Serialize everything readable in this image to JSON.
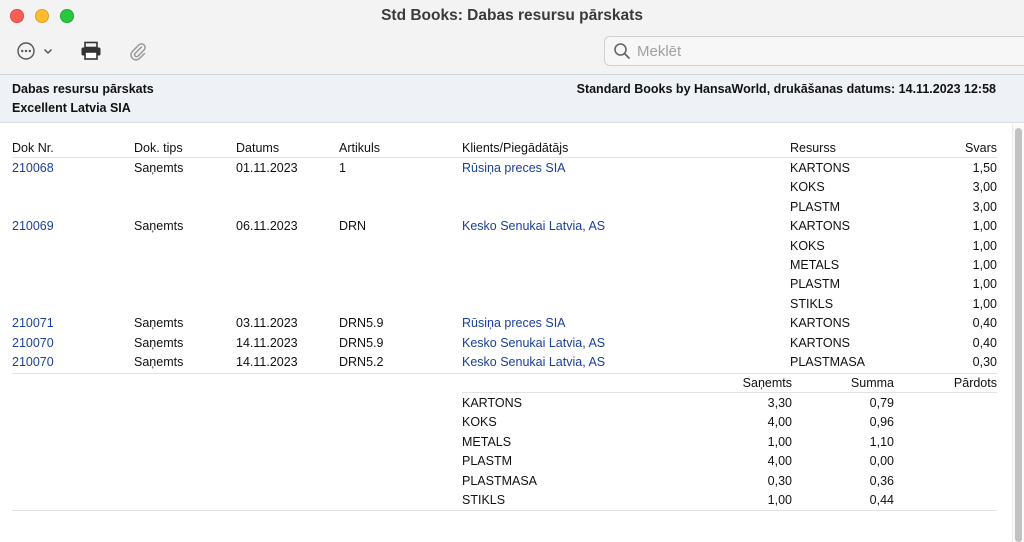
{
  "window": {
    "title": "Std Books: Dabas resursu pārskats"
  },
  "search": {
    "placeholder": "Meklēt"
  },
  "header": {
    "report_title": "Dabas resursu pārskats",
    "company": "Excellent Latvia SIA",
    "printed_info": "Standard Books by HansaWorld, drukāšanas datums: 14.11.2023 12:58"
  },
  "columns": {
    "doc_no": "Dok Nr.",
    "doc_type": "Dok. tips",
    "date": "Datums",
    "item": "Artikuls",
    "client": "Klients/Piegādātājs",
    "resource": "Resurss",
    "weight": "Svars"
  },
  "rows": [
    {
      "doc_no": "210068",
      "doc_type": "Saņemts",
      "date": "01.11.2023",
      "item": "1",
      "client": "Rūsiņa preces SIA",
      "resource": "KARTONS",
      "weight": "1,50"
    },
    {
      "doc_no": "",
      "doc_type": "",
      "date": "",
      "item": "",
      "client": "",
      "resource": "KOKS",
      "weight": "3,00"
    },
    {
      "doc_no": "",
      "doc_type": "",
      "date": "",
      "item": "",
      "client": "",
      "resource": "PLASTM",
      "weight": "3,00"
    },
    {
      "doc_no": "210069",
      "doc_type": "Saņemts",
      "date": "06.11.2023",
      "item": "DRN",
      "client": "Kesko Senukai Latvia, AS",
      "resource": "KARTONS",
      "weight": "1,00"
    },
    {
      "doc_no": "",
      "doc_type": "",
      "date": "",
      "item": "",
      "client": "",
      "resource": "KOKS",
      "weight": "1,00"
    },
    {
      "doc_no": "",
      "doc_type": "",
      "date": "",
      "item": "",
      "client": "",
      "resource": "METALS",
      "weight": "1,00"
    },
    {
      "doc_no": "",
      "doc_type": "",
      "date": "",
      "item": "",
      "client": "",
      "resource": "PLASTM",
      "weight": "1,00"
    },
    {
      "doc_no": "",
      "doc_type": "",
      "date": "",
      "item": "",
      "client": "",
      "resource": "STIKLS",
      "weight": "1,00"
    },
    {
      "doc_no": "210071",
      "doc_type": "Saņemts",
      "date": "03.11.2023",
      "item": "DRN5.9",
      "client": "Rūsiņa preces SIA",
      "resource": "KARTONS",
      "weight": "0,40"
    },
    {
      "doc_no": "210070",
      "doc_type": "Saņemts",
      "date": "14.11.2023",
      "item": "DRN5.9",
      "client": "Kesko Senukai Latvia, AS",
      "resource": "KARTONS",
      "weight": "0,40"
    },
    {
      "doc_no": "210070",
      "doc_type": "Saņemts",
      "date": "14.11.2023",
      "item": "DRN5.2",
      "client": "Kesko Senukai Latvia, AS",
      "resource": "PLASTMASA",
      "weight": "0,30"
    }
  ],
  "summary_columns": {
    "received": "Saņemts",
    "sum": "Summa",
    "sold": "Pārdots"
  },
  "summary": [
    {
      "resource": "KARTONS",
      "received": "3,30",
      "sum": "0,79",
      "sold": ""
    },
    {
      "resource": "KOKS",
      "received": "4,00",
      "sum": "0,96",
      "sold": ""
    },
    {
      "resource": "METALS",
      "received": "1,00",
      "sum": "1,10",
      "sold": ""
    },
    {
      "resource": "PLASTM",
      "received": "4,00",
      "sum": "0,00",
      "sold": ""
    },
    {
      "resource": "PLASTMASA",
      "received": "0,30",
      "sum": "0,36",
      "sold": ""
    },
    {
      "resource": "STIKLS",
      "received": "1,00",
      "sum": "0,44",
      "sold": ""
    }
  ]
}
